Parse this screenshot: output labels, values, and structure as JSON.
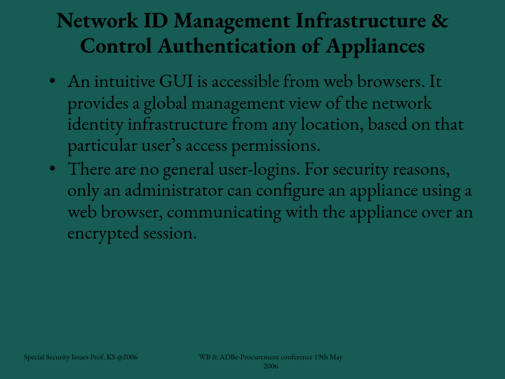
{
  "title": "Network ID Management Infrastructure & Control Authentication of Appliances",
  "bullets": [
    "An intuitive GUI is accessible from web browsers. It provides a global management view of the network identity infrastructure from any location, based on that particular user’s access permissions.",
    "There are no general user-logins. For security reasons, only an administrator can configure an appliance using a web browser, communicating with the appliance over an encrypted session."
  ],
  "footer": {
    "left": "Special Security Issues  Prof. KS @2006",
    "center": "WB & ADBe-Procurement  conference  19th May 2006"
  }
}
